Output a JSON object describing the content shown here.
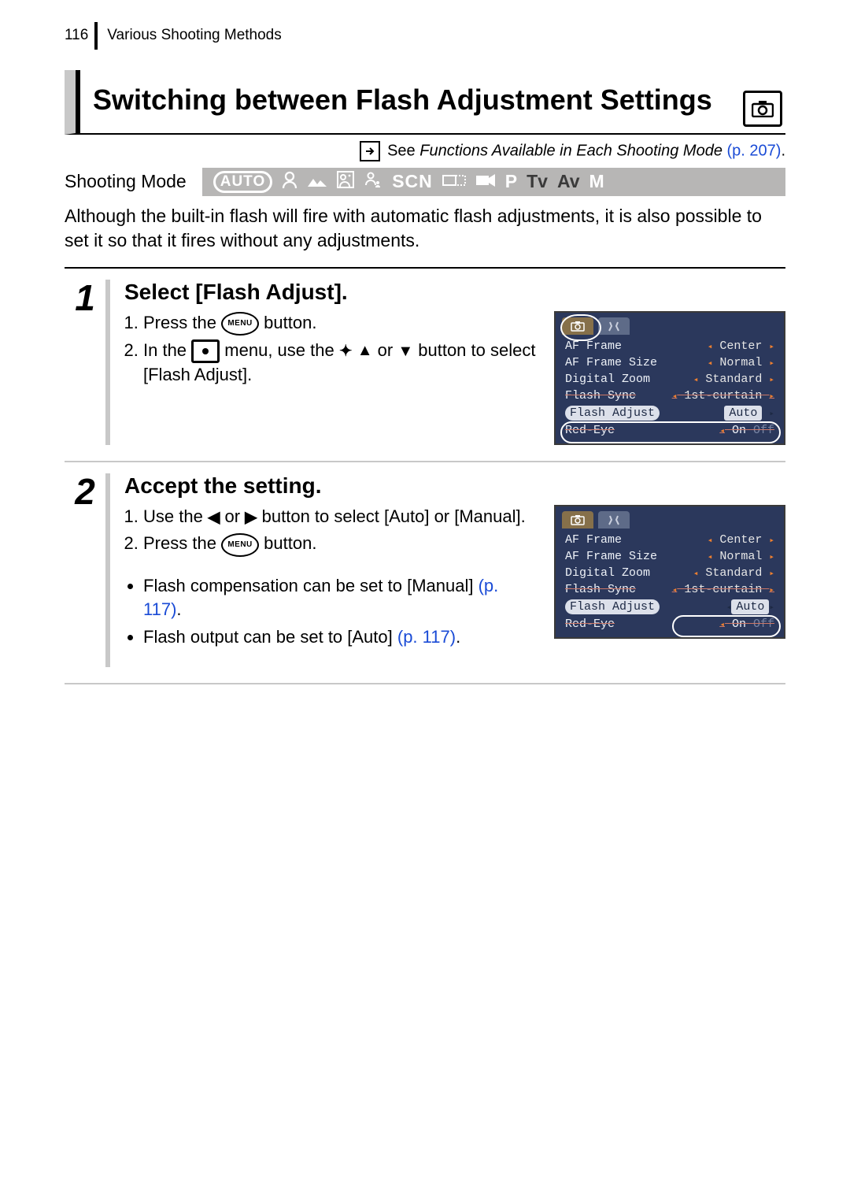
{
  "header": {
    "page_number": "116",
    "section": "Various Shooting Methods"
  },
  "title": "Switching between Flash Adjustment Settings",
  "see_ref": {
    "prefix": "See ",
    "title": "Functions Available in Each Shooting Mode",
    "page": "(p. 207)",
    "dot": "."
  },
  "mode": {
    "label": "Shooting Mode",
    "auto": "AUTO",
    "scn": "SCN",
    "p": "P",
    "tv": "Tv",
    "av": "Av",
    "m": "M"
  },
  "intro": "Although the built-in flash will fire with automatic flash adjustments, it is also possible to set it so that it fires without any adjustments.",
  "steps": [
    {
      "num": "1",
      "title": "Select [Flash Adjust].",
      "press_prefix": "Press the ",
      "press_suffix": " button.",
      "menu_tag": "MENU",
      "inthe_prefix": "In the ",
      "inthe_mid": " menu, use the ",
      "inthe_or": " or ",
      "inthe_suffix": " button to select [Flash Adjust].",
      "lcd": {
        "rows": [
          {
            "label": "AF Frame",
            "value": "Center"
          },
          {
            "label": "AF Frame Size",
            "value": "Normal"
          },
          {
            "label": "Digital Zoom",
            "value": "Standard"
          },
          {
            "label": "Flash Sync",
            "value": "1st-curtain",
            "strike": true
          },
          {
            "label": "Flash Adjust",
            "value": "Auto",
            "hl": true
          },
          {
            "label": "Red-Eye",
            "value": "On Off",
            "strike": true,
            "onoff": true
          }
        ]
      }
    },
    {
      "num": "2",
      "title": "Accept the setting.",
      "use_prefix": "Use the ",
      "use_or": " or ",
      "use_suffix": " button to select [Auto] or [Manual].",
      "press_prefix": "Press the ",
      "press_suffix": " button.",
      "menu_tag": "MENU",
      "bullets": [
        {
          "text": "Flash compensation can be set to [Manual] ",
          "link": "(p. 117)",
          "dot": "."
        },
        {
          "text": "Flash output can be set to [Auto] ",
          "link": "(p. 117)",
          "dot": "."
        }
      ],
      "lcd": {
        "rows": [
          {
            "label": "AF Frame",
            "value": "Center"
          },
          {
            "label": "AF Frame Size",
            "value": "Normal"
          },
          {
            "label": "Digital Zoom",
            "value": "Standard"
          },
          {
            "label": "Flash Sync",
            "value": "1st-curtain",
            "strike": true
          },
          {
            "label": "Flash Adjust",
            "value": "Auto",
            "hl_val": true
          },
          {
            "label": "Red-Eye",
            "value": "On Off",
            "strike": true,
            "onoff": true
          }
        ]
      }
    }
  ]
}
